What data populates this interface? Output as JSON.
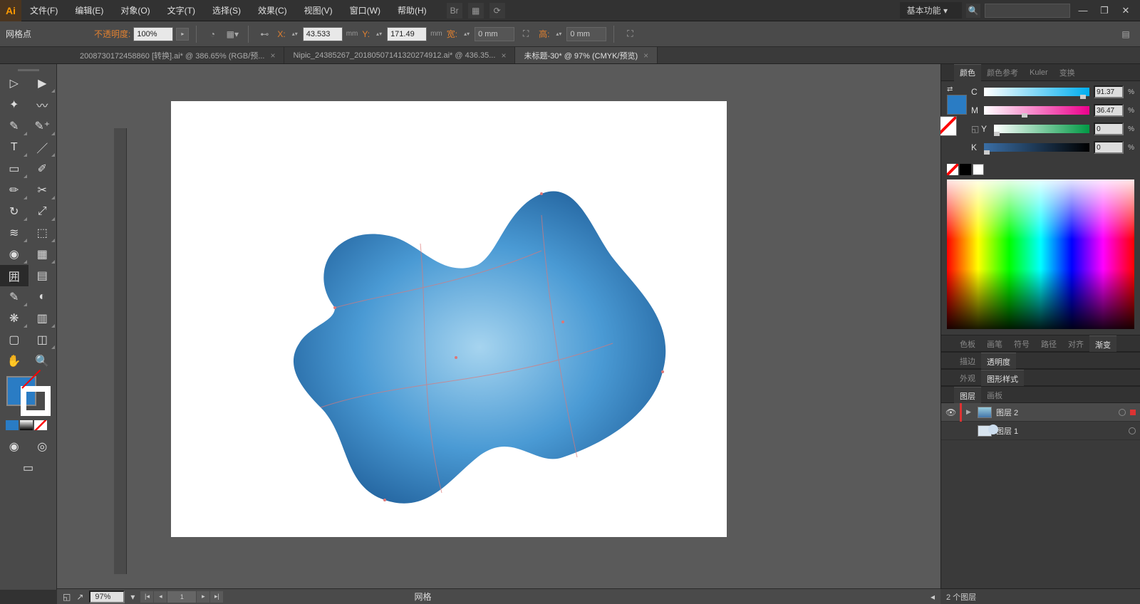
{
  "menubar": {
    "items": [
      "文件(F)",
      "编辑(E)",
      "对象(O)",
      "文字(T)",
      "选择(S)",
      "效果(C)",
      "视图(V)",
      "窗口(W)",
      "帮助(H)"
    ],
    "workspace": "基本功能"
  },
  "controlbar": {
    "tool_label": "网格点",
    "opacity_label": "不透明度:",
    "opacity_value": "100%",
    "x_label": "X:",
    "x_value": "43.533",
    "x_unit": "mm",
    "y_label": "Y:",
    "y_value": "171.49",
    "y_unit": "mm",
    "w_label": "宽:",
    "w_value": "0 mm",
    "h_label": "高:",
    "h_value": "0 mm"
  },
  "tabs": [
    {
      "label": "2008730172458860 [转换].ai* @ 386.65% (RGB/预..."
    },
    {
      "label": "Nipic_24385267_20180507141320274912.ai* @ 436.35..."
    },
    {
      "label": "未标题-30* @ 97% (CMYK/预览)"
    }
  ],
  "color_panel": {
    "tabs": [
      "颜色",
      "颜色参考",
      "Kuler",
      "变换"
    ],
    "c": {
      "label": "C",
      "value": "91.37"
    },
    "m": {
      "label": "M",
      "value": "36.47"
    },
    "y": {
      "label": "Y",
      "value": "0"
    },
    "k": {
      "label": "K",
      "value": "0"
    }
  },
  "mid_panel_tabs_1": [
    "色板",
    "画笔",
    "符号",
    "路径",
    "对齐",
    "渐变"
  ],
  "mid_panel_tabs_2": [
    "描边",
    "透明度"
  ],
  "mid_panel_tabs_3": [
    "外观",
    "图形样式"
  ],
  "layers_panel": {
    "tabs": [
      "图层",
      "画板"
    ],
    "rows": [
      {
        "name": "图层 2",
        "selected": true
      },
      {
        "name": "图层 1",
        "selected": false
      }
    ],
    "footer": "2 个图层"
  },
  "statusbar": {
    "zoom": "97%",
    "tool": "网格"
  }
}
